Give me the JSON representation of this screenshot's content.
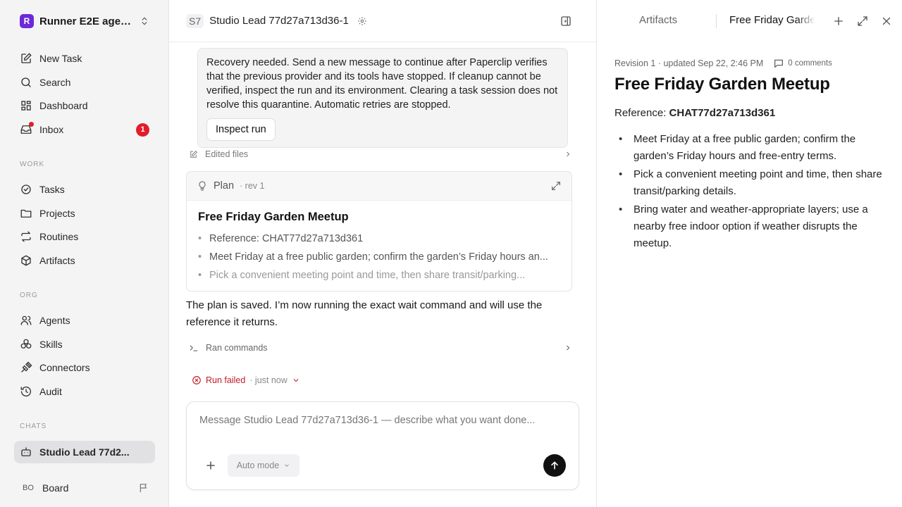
{
  "sidebar": {
    "workspace": {
      "logo": "R",
      "name": "Runner E2E agen..."
    },
    "top_items": [
      {
        "label": "New Task",
        "icon": "edit-icon"
      },
      {
        "label": "Search",
        "icon": "search-icon"
      },
      {
        "label": "Dashboard",
        "icon": "dashboard-icon"
      },
      {
        "label": "Inbox",
        "icon": "inbox-icon",
        "badge": "1"
      }
    ],
    "work_section": "WORK",
    "work_items": [
      {
        "label": "Tasks",
        "icon": "check-circle-icon"
      },
      {
        "label": "Projects",
        "icon": "folder-icon"
      },
      {
        "label": "Routines",
        "icon": "repeat-icon"
      },
      {
        "label": "Artifacts",
        "icon": "box-icon"
      }
    ],
    "org_section": "ORG",
    "org_items": [
      {
        "label": "Agents",
        "icon": "users-icon"
      },
      {
        "label": "Skills",
        "icon": "skills-icon"
      },
      {
        "label": "Connectors",
        "icon": "plug-icon"
      },
      {
        "label": "Audit",
        "icon": "history-icon"
      }
    ],
    "chats_section": "CHATS",
    "chat_item": {
      "label": "Studio Lead 77d2...",
      "icon": "bot-icon"
    },
    "board": {
      "initials": "BO",
      "label": "Board"
    }
  },
  "chat": {
    "header": {
      "badge": "S7",
      "title": "Studio Lead 77d27a713d36-1"
    },
    "recovery": {
      "text": "Recovery needed. Send a new message to continue after Paperclip verifies that the previous provider and its tools have stopped. If cleanup cannot be verified, inspect the run and its environment. Clearing a task session does not resolve this quarantine. Automatic retries are stopped.",
      "button": "Inspect run"
    },
    "edited_files": "Edited files",
    "plan": {
      "label": "Plan",
      "rev": "· rev 1",
      "title": "Free Friday Garden Meetup",
      "items": [
        "Reference: CHAT77d27a713d361",
        "Meet Friday at a free public garden; confirm the garden’s Friday hours an...",
        "Pick a convenient meeting point and time, then share transit/parking..."
      ]
    },
    "message": "The plan is saved. I’m now running the exact wait command and will use the reference it returns.",
    "ran_commands": "Ran commands",
    "status": {
      "label": "Run failed",
      "time": "· just now",
      "color": "#c01c28"
    },
    "composer": {
      "placeholder": "Message Studio Lead 77d27a713d36-1 — describe what you want done...",
      "mode": "Auto mode"
    }
  },
  "artifact_panel": {
    "tab_artifacts": "Artifacts",
    "tab_current": "Free Friday Garden Meetup",
    "revision": "Revision 1 · updated Sep 22, 2:46 PM",
    "comments": "0 comments",
    "title": "Free Friday Garden Meetup",
    "reference_label": "Reference:",
    "reference_value": "CHAT77d27a713d361",
    "items": [
      "Meet Friday at a free public garden; confirm the garden’s Friday hours and free-entry terms.",
      "Pick a convenient meeting point and time, then share transit/parking details.",
      "Bring water and weather-appropriate layers; use a nearby free indoor option if weather disrupts the meetup."
    ]
  },
  "colors": {
    "accent": "#6d28d9",
    "badge": "#e11d2a",
    "error": "#c01c28"
  }
}
